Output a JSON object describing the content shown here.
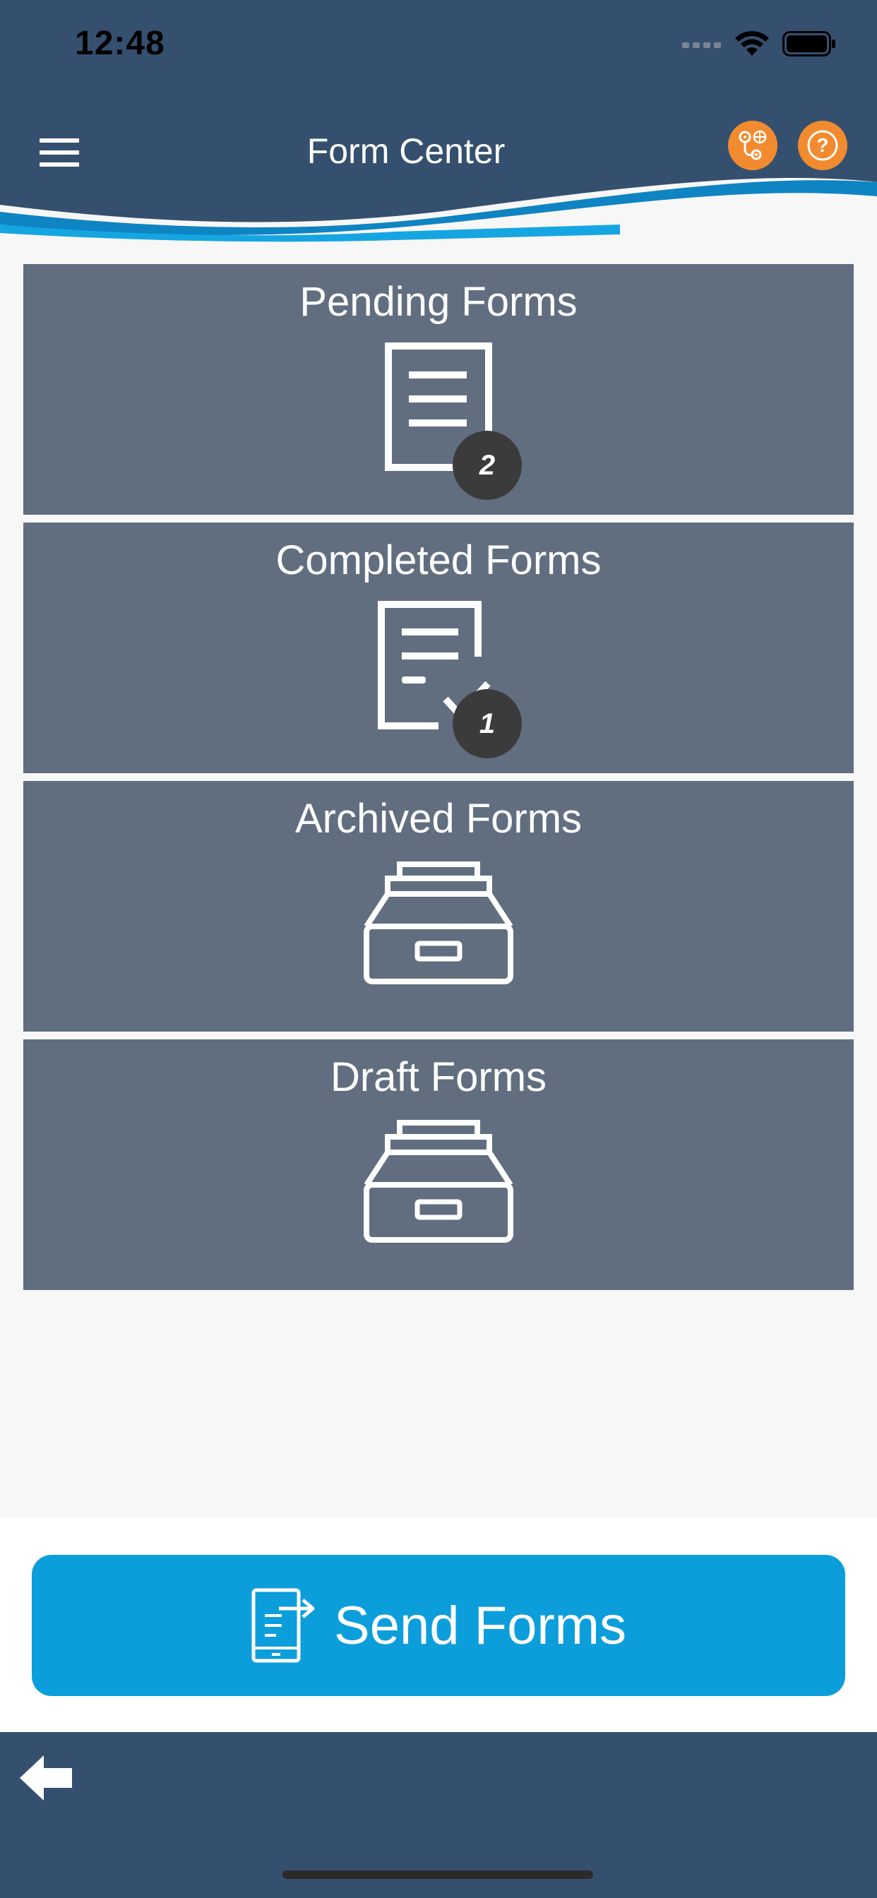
{
  "status_bar": {
    "time": "12:48"
  },
  "header": {
    "title": "Form Center",
    "menu_icon": "hamburger-menu-icon",
    "location_icon": "map-location-icon",
    "help_icon": "question-mark-icon",
    "help_glyph": "?",
    "accent_color": "#f28b2f",
    "bar_color": "#35506f"
  },
  "cards": [
    {
      "label": "Pending Forms",
      "icon": "document-icon",
      "badge": "2"
    },
    {
      "label": "Completed Forms",
      "icon": "document-check-icon",
      "badge": "1"
    },
    {
      "label": "Archived Forms",
      "icon": "archive-drawer-icon"
    },
    {
      "label": "Draft Forms",
      "icon": "archive-drawer-icon"
    }
  ],
  "send_button": {
    "label": "Send Forms",
    "icon": "send-device-icon",
    "color": "#0c9edb"
  },
  "footer": {
    "back_icon": "back-arrow-icon"
  }
}
